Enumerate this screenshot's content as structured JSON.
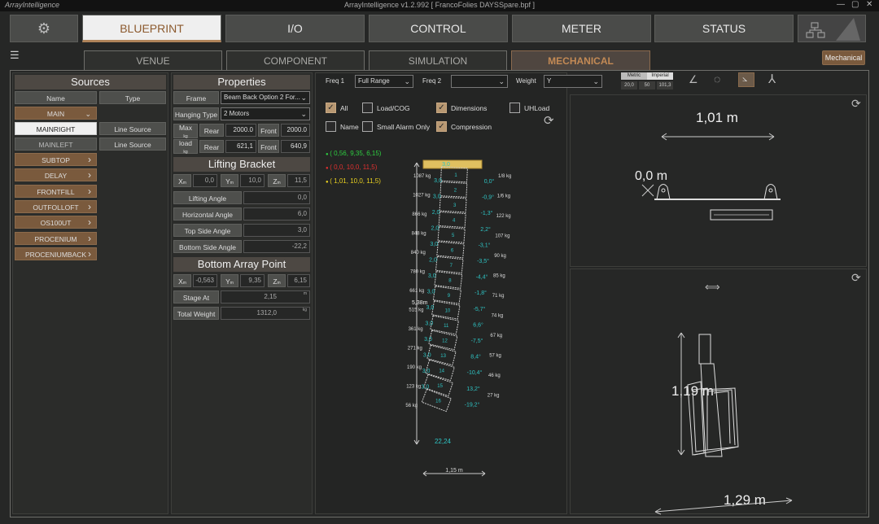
{
  "app": {
    "name": "ArrayIntelligence",
    "title": "ArrayIntelligence v1.2.992 [ FrancoFolies DAYSSpare.bpf ]"
  },
  "window_controls": {
    "minimize": "—",
    "maximize": "▢",
    "close": "✕"
  },
  "nav": {
    "settings_icon": "camera-gear-icon",
    "items": [
      "BLUEPRINT",
      "I/O",
      "CONTROL",
      "METER",
      "STATUS"
    ],
    "active": "BLUEPRINT",
    "network_icon": "network-icon"
  },
  "tabs": {
    "items": [
      "VENUE",
      "COMPONENT",
      "SIMULATION",
      "MECHANICAL"
    ],
    "active": "MECHANICAL",
    "right_button": "Mechanical"
  },
  "sources": {
    "title": "Sources",
    "col_name": "Name",
    "col_type": "Type",
    "items": [
      {
        "name": "MAIN",
        "type": "",
        "expanded": true
      },
      {
        "name": "MAINRIGHT",
        "type": "Line Source"
      },
      {
        "name": "MAINLEFT",
        "type": "Line Source"
      },
      {
        "name": "SUBTOP",
        "type": ""
      },
      {
        "name": "DELAY",
        "type": ""
      },
      {
        "name": "FRONTFILL",
        "type": ""
      },
      {
        "name": "OUTFOLLOFT",
        "type": ""
      },
      {
        "name": "OS100UT",
        "type": ""
      },
      {
        "name": "PROCENIUM",
        "type": ""
      },
      {
        "name": "PROCENIUMBACK",
        "type": ""
      }
    ]
  },
  "properties": {
    "title": "Properties",
    "frame_label": "Frame",
    "frame_value": "Beam Back Option 2 For...",
    "hanging_label": "Hanging Type",
    "hanging_value": "2 Motors",
    "max_label": "Max",
    "max_unit": "kg",
    "load_label": "load",
    "load_unit": "kg",
    "rear_label": "Rear",
    "front_label": "Front",
    "max_rear": "2000.0",
    "max_front": "2000.0",
    "load_rear": "621,1",
    "load_front": "640,9"
  },
  "lifting_bracket": {
    "title": "Lifting Bracket",
    "x_label": "X",
    "y_label": "Y",
    "z_label": "Z",
    "unit": "m",
    "x": "0,0",
    "y": "10,0",
    "z": "11,5",
    "lifting_angle_label": "Lifting Angle",
    "lifting_angle": "0,0",
    "horizontal_angle_label": "Horizontal Angle",
    "horizontal_angle": "6,0",
    "top_side_angle_label": "Top Side Angle",
    "top_side_angle": "3,0",
    "bottom_side_angle_label": "Bottom Side Angle",
    "bottom_side_angle": "-22,2"
  },
  "bottom_array": {
    "title": "Bottom Array Point",
    "x": "-0,563",
    "y": "9,35",
    "z": "6,15",
    "stage_at_label": "Stage At",
    "stage_at": "2,15",
    "stage_unit": "m",
    "total_weight_label": "Total Weight",
    "total_weight": "1312,0",
    "weight_unit": "kg"
  },
  "center_toolbar": {
    "freq1_label": "Freq 1",
    "freq1_value": "Full Range",
    "freq2_label": "Freq 2",
    "freq2_value": "",
    "weight_label": "Weight",
    "weight_value": "Y",
    "metric_label": "Metric",
    "imperial_label": "Imperial",
    "metric_values": [
      "20,0",
      "50",
      "101,3"
    ]
  },
  "checkboxes": [
    {
      "label": "All",
      "checked": true
    },
    {
      "label": "Load/COG",
      "checked": false
    },
    {
      "label": "Dimensions",
      "checked": true
    },
    {
      "label": "UHLoad",
      "checked": false
    },
    {
      "label": "Name",
      "checked": false
    },
    {
      "label": "Small Alarm Only",
      "checked": false
    },
    {
      "label": "Compression",
      "checked": true
    }
  ],
  "points": [
    {
      "text": "( 0,56, 9,35, 6,15)",
      "color": "#2ecc40"
    },
    {
      "text": "( 0,0, 10,0, 11,5)",
      "color": "#e03030"
    },
    {
      "text": "( 1,01, 10,0, 11,5)",
      "color": "#e8d020"
    }
  ],
  "array": {
    "top_value": "3,0",
    "left_weights": [
      "1087 kg",
      "1027 kg",
      "866 kg",
      "848 kg",
      "840 kg",
      "780 kg",
      "661 kg",
      "515 kg",
      "361 kg",
      "271 kg",
      "190 kg",
      "123 kg",
      "56 kg"
    ],
    "right_weights": [
      "1/8 kg",
      "1/6 kg",
      "122 kg",
      "107 kg",
      "90 kg",
      "85 kg",
      "71 kg",
      "74 kg",
      "67 kg",
      "57 kg",
      "46 kg",
      "27 kg"
    ],
    "angles_left": [
      "3,0",
      "3,0",
      "2,0",
      "2,0",
      "3,0",
      "2,0",
      "3,0",
      "3,0",
      "3,0",
      "3,0",
      "3,0",
      "3,0",
      "3,0",
      "3,0"
    ],
    "angles_right": [
      "0,0°",
      "-0,9°",
      "-1,3°",
      "2,2°",
      "-3,1°",
      "-3,5°",
      "-4,4°",
      "-1,8°",
      "-5,7°",
      "6,6°",
      "-7,5°",
      "8,4°",
      "-10,4°",
      "13,2°",
      "-19,2°"
    ],
    "box_numbers": [
      "1",
      "2",
      "3",
      "4",
      "5",
      "6",
      "7",
      "8",
      "9",
      "10",
      "11",
      "12",
      "13",
      "14",
      "15",
      "16"
    ],
    "height_label": "5,38m",
    "bottom_value": "22,24",
    "width_label": "1,15 m"
  },
  "top_view": {
    "width_label": "1,01 m",
    "origin_label": "0,0 m"
  },
  "side_view": {
    "height_label": "1,19 m",
    "width_label": "1,29 m"
  }
}
